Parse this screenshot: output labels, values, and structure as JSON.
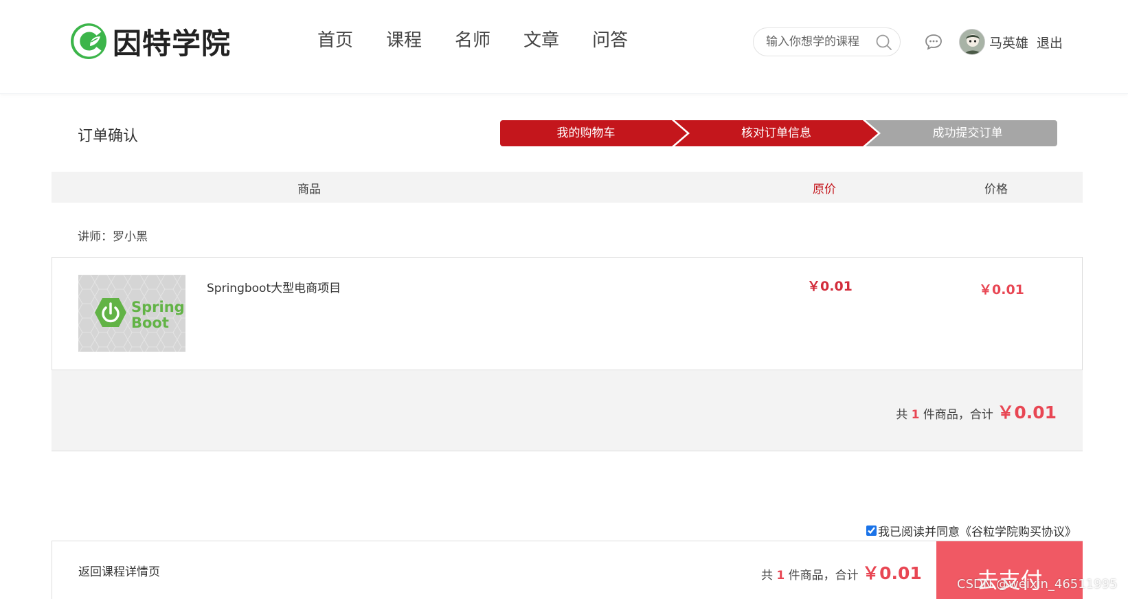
{
  "header": {
    "logo_text": "因特学院",
    "nav": [
      "首页",
      "课程",
      "名师",
      "文章",
      "问答"
    ],
    "search_placeholder": "输入你想学的课程",
    "username": "马英雄",
    "logout": "退出"
  },
  "order": {
    "title": "订单确认",
    "steps": [
      {
        "label": "我的购物车",
        "state": "done",
        "color": "#c4161c"
      },
      {
        "label": "核对订单信息",
        "state": "active",
        "color": "#c4161c"
      },
      {
        "label": "成功提交订单",
        "state": "pending",
        "color": "#a6a6a6"
      }
    ],
    "table_headers": {
      "product": "商品",
      "original_price": "原价",
      "price": "价格"
    },
    "teacher": "讲师：罗小黑",
    "item": {
      "image_text": [
        "Spring",
        "Boot"
      ],
      "name": "Springboot大型电商项目",
      "original_price": "￥0.01",
      "price": "￥0.01"
    },
    "summary": {
      "prefix": "共",
      "count": "1",
      "middle": "件商品，合计",
      "total": "￥0.01"
    },
    "agreement": {
      "checked": true,
      "text": "我已阅读并同意《谷粒学院购买协议》"
    },
    "bottom": {
      "back_link": "返回课程详情页",
      "prefix": "共",
      "count": "1",
      "middle": "件商品，合计",
      "total": "￥0.01",
      "pay_button": "去支付"
    }
  },
  "watermark": "CSDN @weixin_46511995",
  "colors": {
    "accent_red": "#e84653",
    "step_red": "#c4161c",
    "step_gray": "#a6a6a6",
    "logo_green": "#3cb54a",
    "pay_button": "#f05964"
  }
}
